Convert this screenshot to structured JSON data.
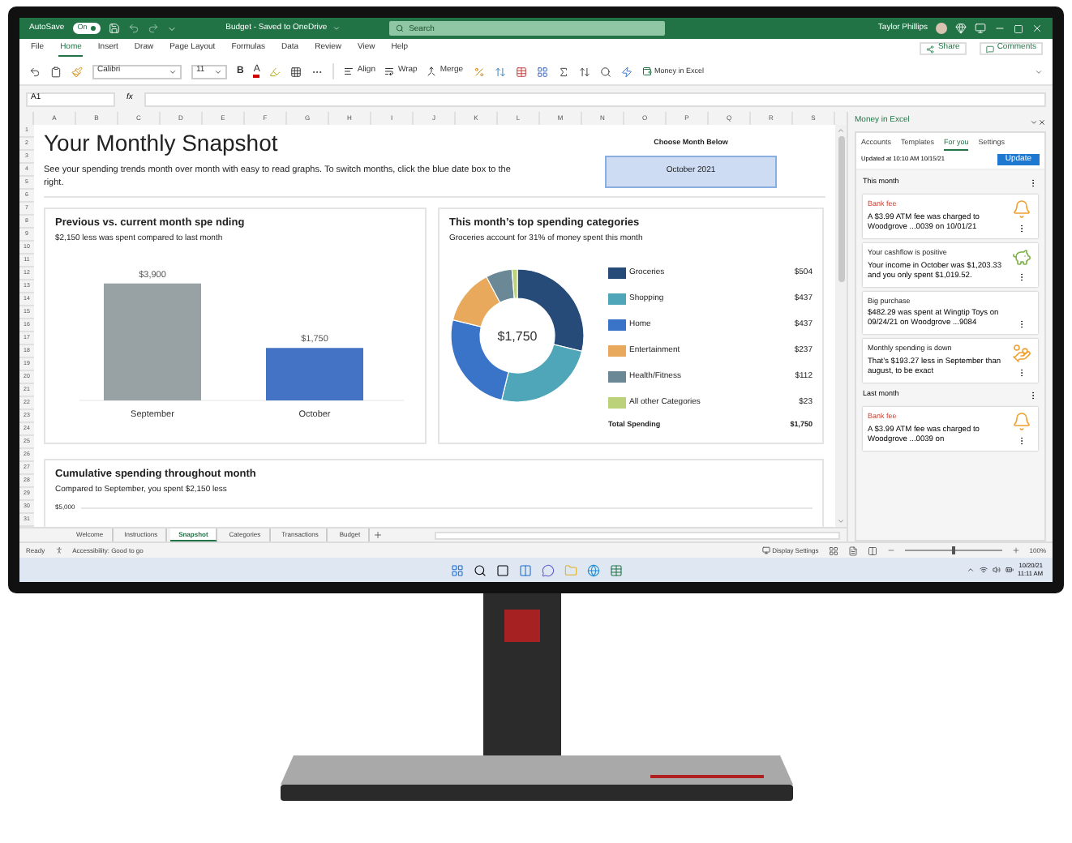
{
  "title_bar": {
    "autosave_label": "AutoSave",
    "autosave_toggle": {
      "label": "On",
      "on": true
    },
    "document_title": "Budget - Saved to OneDrive",
    "search": {
      "placeholder": "Search"
    },
    "user_name": "Taylor Phillips"
  },
  "menu_tabs": [
    {
      "label": "File",
      "selected": false
    },
    {
      "label": "Home",
      "selected": true
    },
    {
      "label": "Insert",
      "selected": false
    },
    {
      "label": "Draw",
      "selected": false
    },
    {
      "label": "Page Layout",
      "selected": false
    },
    {
      "label": "Formulas",
      "selected": false
    },
    {
      "label": "Data",
      "selected": false
    },
    {
      "label": "Review",
      "selected": false
    },
    {
      "label": "View",
      "selected": false
    },
    {
      "label": "Help",
      "selected": false
    }
  ],
  "share_button": "Share",
  "comments_button": "Comments",
  "ribbon": {
    "font_name": "Calibri",
    "font_size": "11",
    "bold_label": "B",
    "font_color_label": "A",
    "align_label": "Align",
    "wrap_label": "Wrap",
    "merge_label": "Merge",
    "money_in_excel_label": "Money in Excel"
  },
  "formula_bar": {
    "name_box": "A1",
    "fx_label": "fx"
  },
  "columns": [
    "A",
    "B",
    "C",
    "D",
    "E",
    "F",
    "G",
    "H",
    "I",
    "J",
    "K",
    "L",
    "M",
    "N",
    "O",
    "P",
    "Q",
    "R",
    "S"
  ],
  "rows": [
    "1",
    "2",
    "3",
    "4",
    "5",
    "6",
    "7",
    "8",
    "9",
    "10",
    "11",
    "12",
    "13",
    "14",
    "15",
    "16",
    "17",
    "18",
    "19",
    "20",
    "21",
    "22",
    "23",
    "24",
    "25",
    "26",
    "27",
    "28",
    "29",
    "30",
    "31"
  ],
  "snapshot": {
    "title": "Your Monthly Snapshot",
    "description": "See your spending trends month over month with easy to read graphs. To switch months, click the blue date box to the right.",
    "month_picker": {
      "label": "Choose Month Below",
      "value": "October 2021"
    }
  },
  "comparison_card": {
    "title": "Previous vs. current month spe nding",
    "subtitle": "$2,150 less was spent compared to last month",
    "chart_data": {
      "type": "bar",
      "categories": [
        "September",
        "October"
      ],
      "values": [
        3900,
        1750
      ],
      "colors": [
        "#98a2a4",
        "#4472c4"
      ],
      "value_labels": [
        "$3,900",
        "$1,750"
      ],
      "ylim": [
        0,
        4000
      ]
    }
  },
  "categories_card": {
    "title": "This month’s top spending categories",
    "subtitle": "Groceries account for 31% of money spent this month",
    "center_label": "$1,750",
    "chart_data": {
      "type": "donut",
      "categories": [
        "Groceries",
        "Shopping",
        "Home",
        "Entertainment",
        "Health/Fitness",
        "All other Categories"
      ],
      "values": [
        28.8,
        25,
        25,
        13.5,
        6.4,
        1.3
      ],
      "colors": [
        "#264b78",
        "#4ea6b8",
        "#3a74c8",
        "#e8a95c",
        "#6a8896",
        "#bcd27a"
      ]
    },
    "legend_amounts": [
      "$504",
      "$437",
      "$437",
      "$237",
      "$112",
      "$23"
    ],
    "total_label": "Total Spending",
    "total_value": "$1,750"
  },
  "cumulative_card": {
    "title": "Cumulative spending throughout month",
    "subtitle": "Compared to September, you spent $2,150 less",
    "y_tick": "$5,000"
  },
  "sheet_tabs": [
    {
      "label": "Welcome",
      "selected": false
    },
    {
      "label": "Instructions",
      "selected": false
    },
    {
      "label": "Snapshot",
      "selected": true
    },
    {
      "label": "Categories",
      "selected": false
    },
    {
      "label": "Transactions",
      "selected": false
    },
    {
      "label": "Budget",
      "selected": false
    }
  ],
  "status_bar": {
    "status": "Ready",
    "accessibility": "Accessibility: Good to go",
    "display_settings": "Display Settings",
    "zoom": {
      "level": 0.5,
      "reading": "100%"
    }
  },
  "task_pane": {
    "title": "Money in Excel",
    "tabs": [
      {
        "label": "Accounts",
        "selected": false
      },
      {
        "label": "Templates",
        "selected": false
      },
      {
        "label": "For you",
        "selected": true
      },
      {
        "label": "Settings",
        "selected": false
      }
    ],
    "updated": "Updated at 10:10 AM 10/15/21",
    "update_button": "Update",
    "sections": [
      {
        "heading": "This month",
        "cards": [
          {
            "kind": "fee",
            "title": "Bank fee",
            "text": "A $3.99 ATM fee was charged to Woodgrove ...0039 on 10/01/21"
          },
          {
            "kind": "cashflow",
            "title": "Your cashflow is positive",
            "text": "Your income in October was $1,203.33 and you only spent $1,019.52."
          },
          {
            "kind": "purchase",
            "title": "Big purchase",
            "text": "$482.29 was spent at Wingtip Toys on 09/24/21 on Woodgrove ...9084"
          },
          {
            "kind": "spending",
            "title": "Monthly spending is down",
            "text": "That’s $193.27 less in September than august, to be exact"
          }
        ]
      },
      {
        "heading": "Last month",
        "cards": [
          {
            "kind": "fee",
            "title": "Bank fee",
            "text": "A $3.99 ATM fee was charged to Woodgrove ...0039 on"
          }
        ]
      }
    ]
  },
  "taskbar": {
    "date": "10/20/21",
    "time": "11:11 AM"
  }
}
